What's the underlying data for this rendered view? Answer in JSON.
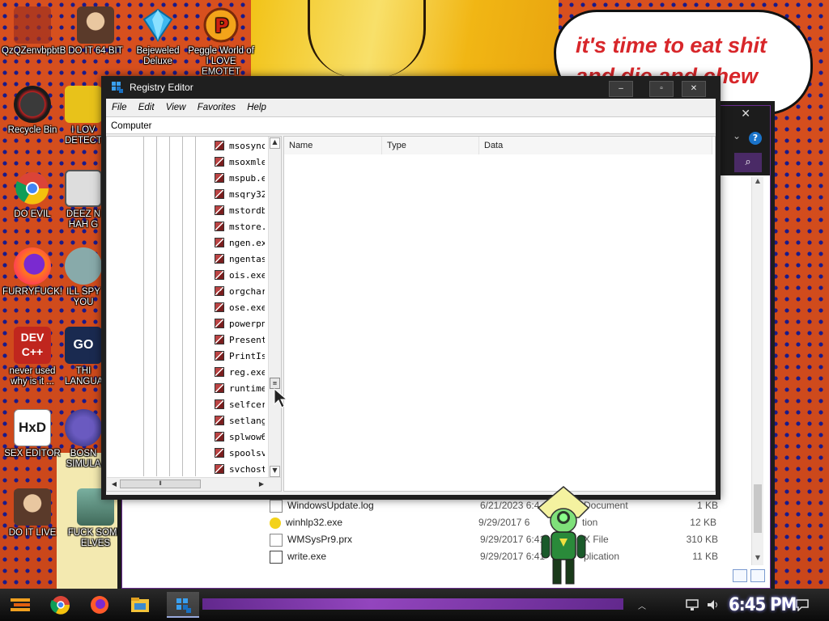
{
  "desktop": {
    "speech_bubble": "it's time to eat shit and die and chew",
    "icons": [
      {
        "label": "QzQZenvbpbtB"
      },
      {
        "label": "DO IT 64 BIT"
      },
      {
        "label": "Bejeweled Deluxe"
      },
      {
        "label": "Peggle World of I LOVE EMOTET Warcraft Edition"
      },
      {
        "label": "Recycle Bin"
      },
      {
        "label": "I LOV DETECTI"
      },
      {
        "label": "DO EVIL"
      },
      {
        "label": "DEEZ N HAH G"
      },
      {
        "label": "FURRYFUCK!"
      },
      {
        "label": "ILL SPY YOU"
      },
      {
        "label": "never used why is it ..."
      },
      {
        "label": "THI LANGUA"
      },
      {
        "label": "SEX EDITOR"
      },
      {
        "label": "BOSN SIMULA"
      },
      {
        "label": "DO IT LIVE"
      },
      {
        "label": "FUCK SOME ELVES"
      }
    ]
  },
  "regedit": {
    "title": "Registry Editor",
    "controls": {
      "minimize": "–",
      "maximize": "▫",
      "close": "✕"
    },
    "menu": [
      "File",
      "Edit",
      "View",
      "Favorites",
      "Help"
    ],
    "address": "Computer",
    "tree_items": [
      "msosync.",
      "msoxmle",
      "mspub.ex",
      "msqry32",
      "mstordb.",
      "mstore.e",
      "ngen.exe",
      "ngentask",
      "ois.exe",
      "orgchart",
      "ose.exe",
      "powerpn",
      "Presenta",
      "PrintIsol",
      "reg.exe",
      "runtimeb",
      "selfcert.",
      "setlang.e",
      "splwow6",
      "spoolsv.e",
      "svchost.e"
    ],
    "columns": [
      "Name",
      "Type",
      "Data"
    ]
  },
  "explorer": {
    "files": [
      {
        "name": "WindowsUpdate.log",
        "date": "6/21/2023 6:4",
        "type": "Document",
        "size": "1 KB"
      },
      {
        "name": "winhlp32.exe",
        "date": "9/29/2017 6",
        "type": "tion",
        "size": "12 KB"
      },
      {
        "name": "WMSysPr9.prx",
        "date": "9/29/2017 6:41",
        "type": "X File",
        "size": "310 KB"
      },
      {
        "name": "write.exe",
        "date": "9/29/2017 6:41",
        "type": "plication",
        "size": "11 KB"
      }
    ]
  },
  "taskbar": {
    "clock": "6:45 PM"
  }
}
